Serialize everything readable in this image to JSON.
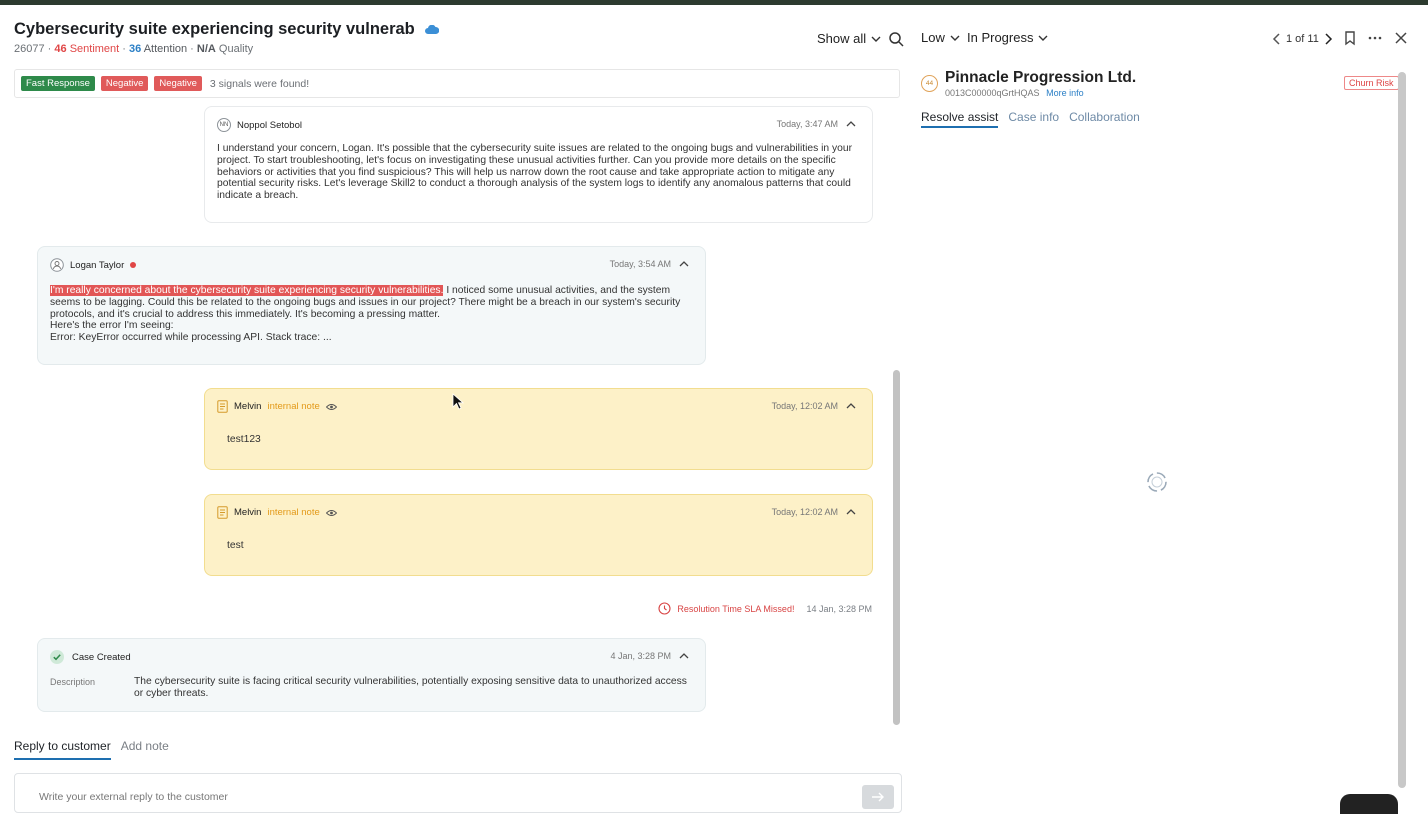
{
  "header": {
    "title": "Cybersecurity suite experiencing security vulnerab",
    "case_number": "26077",
    "sentiment_value": "46",
    "sentiment_label": "Sentiment",
    "attention_value": "36",
    "attention_label": "Attention",
    "quality_value": "N/A",
    "quality_label": "Quality",
    "show_all_label": "Show all",
    "priority": "Low",
    "status": "In Progress",
    "pager": "1 of 11"
  },
  "signals": {
    "tags": [
      "Fast Response",
      "Negative",
      "Negative"
    ],
    "summary": "3 signals were found!"
  },
  "messages": [
    {
      "author": "Noppol Setobol",
      "avatar": "NN",
      "time": "Today, 3:47 AM",
      "text": "I understand your concern, Logan. It's possible that the cybersecurity suite issues are related to the ongoing bugs and vulnerabilities in your project. To start troubleshooting, let's focus on investigating these unusual activities further. Can you provide more details on the specific behaviors or activities that you find suspicious? This will help us narrow down the root cause and take appropriate action to mitigate any potential security risks. Let's leverage Skill2 to conduct a thorough analysis of the system logs to identify any anomalous patterns that could indicate a breach."
    },
    {
      "author": "Logan Taylor",
      "time": "Today, 3:54 AM",
      "highlight": "I'm really concerned about the cybersecurity suite experiencing security vulnerabilities.",
      "text": " I noticed some unusual activities, and the system seems to be lagging. Could this be related to the ongoing bugs and issues in our project? There might be a breach in our system's security protocols, and it's crucial to address this immediately. It's becoming a pressing matter.",
      "line2": "Here's the error I'm seeing:",
      "line3": "Error: KeyError occurred while processing API. Stack trace: ..."
    },
    {
      "author": "Melvin",
      "tag": "internal note",
      "time": "Today, 12:02 AM",
      "text": "test123"
    },
    {
      "author": "Melvin",
      "tag": "internal note",
      "time": "Today, 12:02 AM",
      "text": "test"
    }
  ],
  "sla": {
    "message": "Resolution Time SLA Missed!",
    "time": "14 Jan, 3:28 PM"
  },
  "case_created": {
    "label": "Case Created",
    "time": "4 Jan, 3:28 PM",
    "description_label": "Description",
    "description": "The cybersecurity suite is facing critical security vulnerabilities, potentially exposing sensitive data to unauthorized access or cyber threats."
  },
  "reply": {
    "tabs": [
      "Reply to customer",
      "Add note"
    ],
    "placeholder": "Write your external reply to the customer"
  },
  "account": {
    "logo_text": "44",
    "name": "Pinnacle Progression Ltd.",
    "id": "0013C00000qGrtHQAS",
    "more_info": "More info",
    "badge": "Churn Risk",
    "tabs": [
      "Resolve assist",
      "Case info",
      "Collaboration"
    ]
  },
  "colors": {
    "accent": "#1e6fb0",
    "negative": "#e05a5a",
    "positive": "#2e8a4a",
    "note_bg": "#fdf1c8"
  }
}
